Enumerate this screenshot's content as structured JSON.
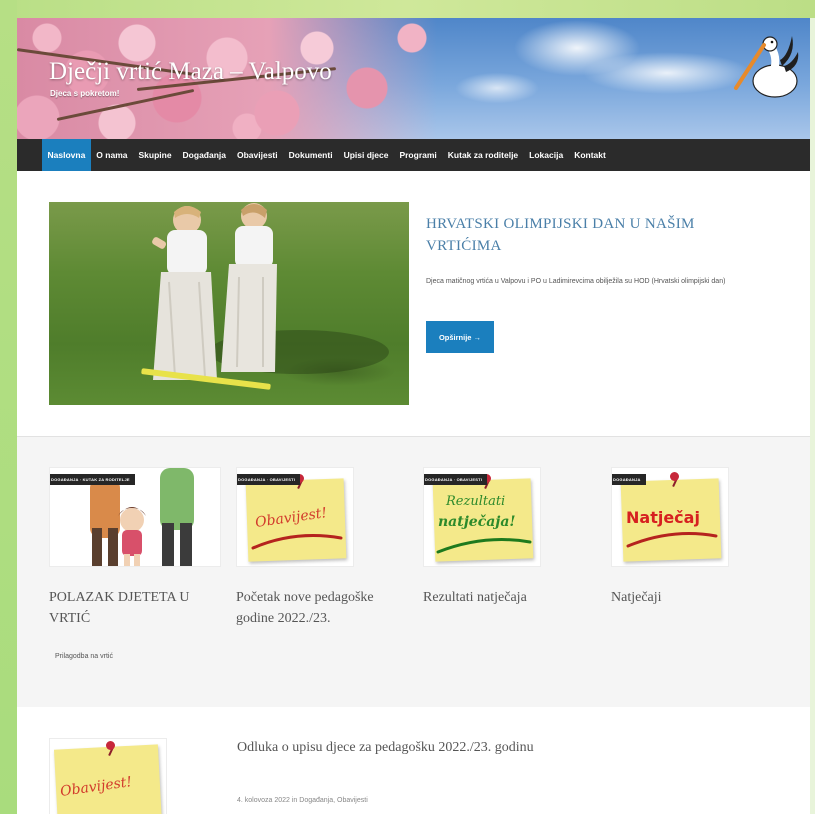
{
  "site": {
    "title": "Dječji vrtić Maza – Valpovo",
    "tagline": "Djeca s pokretom!"
  },
  "nav": {
    "items": [
      {
        "label": "Naslovna",
        "active": true
      },
      {
        "label": "O nama"
      },
      {
        "label": "Skupine"
      },
      {
        "label": "Događanja"
      },
      {
        "label": "Obavijesti"
      },
      {
        "label": "Dokumenti"
      },
      {
        "label": "Upisi djece"
      },
      {
        "label": "Programi"
      },
      {
        "label": "Kutak za roditelje"
      },
      {
        "label": "Lokacija"
      },
      {
        "label": "Kontakt"
      }
    ]
  },
  "featured": {
    "title": "HRVATSKI OLIMPIJSKI DAN U NAŠIM VRTIĆIMA",
    "excerpt": "Djeca matičnog vrtića u Valpovu i PO u Ladimirevcima obilježila su HOD (Hrvatski olimpijski dan)",
    "button_label": "Opširnije →"
  },
  "cards": [
    {
      "badge": "DOGAĐANJA · KUTAK ZA RODITELJE",
      "title": "POLAZAK DJETETA U VRTIĆ",
      "excerpt": "Prilagodba na vrtić"
    },
    {
      "badge": "DOGAĐANJA · OBAVIJESTI",
      "title": "Početak nove pedagoške godine 2022./23.",
      "note_text": "Obavijest!"
    },
    {
      "badge": "DOGAĐANJA · OBAVIJESTI",
      "title": "Rezultati natječaja",
      "note_text_1": "Rezultati",
      "note_text_2": "natječaja!"
    },
    {
      "badge": "DOGAĐANJA",
      "title": "Natječaji",
      "note_text": "Natječaj"
    }
  ],
  "list_post": {
    "title": "Odluka o upisu djece za pedagošku 2022./23. godinu",
    "meta": "4. kolovoza 2022 in Događanja, Obavijesti",
    "note_text": "Obavijest!"
  },
  "colors": {
    "nav_bg": "#2b2b2b",
    "accent": "#1b7fbe",
    "frame_green": "#b6df85",
    "note_yellow": "#f4e98a"
  }
}
